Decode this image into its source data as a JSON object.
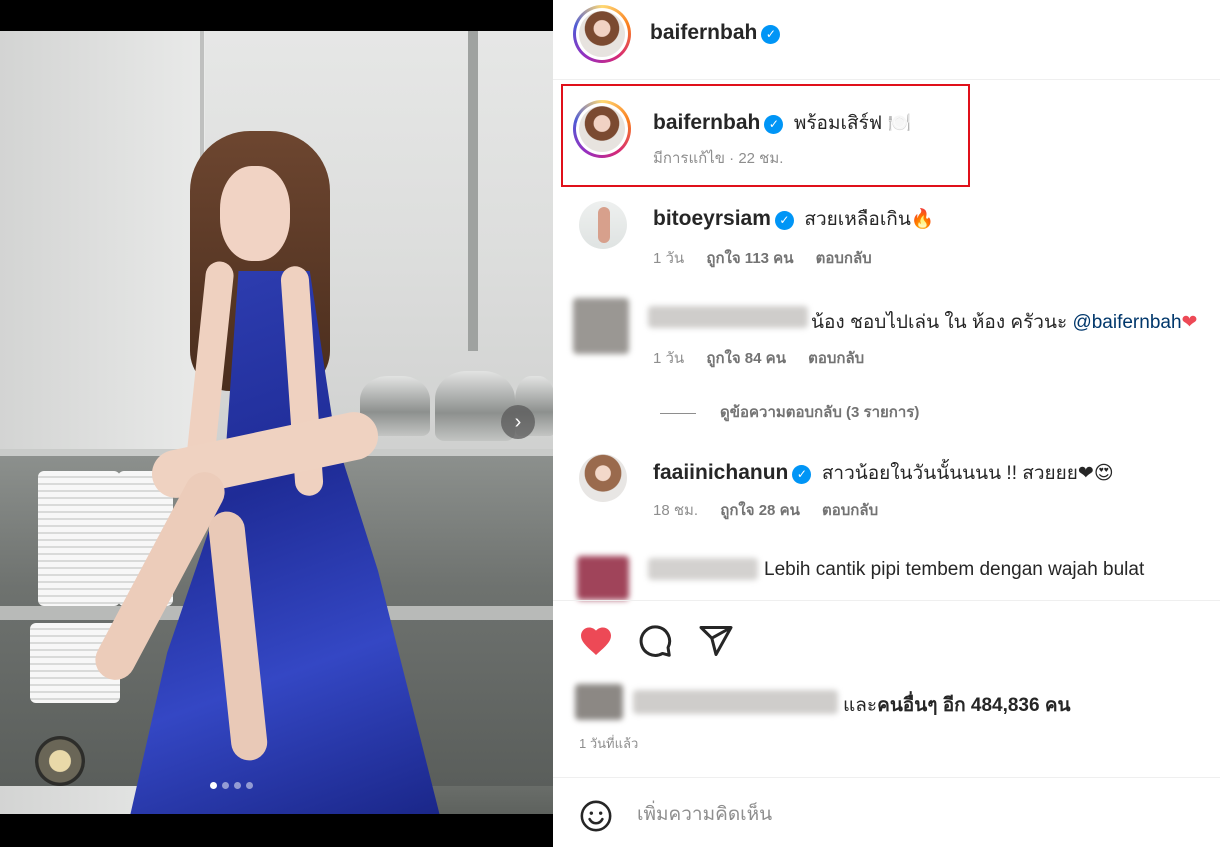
{
  "post": {
    "image_slides": 4,
    "active_slide": 1
  },
  "header": {
    "username": "baifernbah",
    "verified_glyph": "✓"
  },
  "caption": {
    "username": "baifernbah",
    "text": "พร้อมเสิร์ฟ 🍽️",
    "edited_label": "มีการแก้ไข · 22 ชม."
  },
  "comments": [
    {
      "username": "bitoeyrsiam",
      "text": "สวยเหลือเกิน🔥",
      "time": "1 วัน",
      "likes": "ถูกใจ 113 คน",
      "reply": "ตอบกลับ"
    },
    {
      "username": "",
      "text": "น้อง ชอบไปเล่น ใน ห้อง ครัวนะ ",
      "mention": "@baifernbah",
      "emoji": "❤",
      "time": "1 วัน",
      "likes": "ถูกใจ 84 คน",
      "reply": "ตอบกลับ",
      "view_replies": "ดูข้อความตอบกลับ (3 รายการ)"
    },
    {
      "username": "faaiinichanun",
      "text": "สาวน้อยในวันนั้นนนน !! สวยยย❤😍",
      "time": "18 ชม.",
      "likes": "ถูกใจ 28 คน",
      "reply": "ตอบกลับ"
    },
    {
      "username": "",
      "text": "Lebih cantik pipi tembem dengan wajah bulat"
    }
  ],
  "actions": {
    "like_icon": "heart-filled-icon",
    "comment_icon": "comment-bubble-icon",
    "share_icon": "paper-plane-icon",
    "like_color": "#ed4956"
  },
  "likes_summary": {
    "prefix": "และ",
    "bold": "คนอื่นๆ อีก 484,836 คน"
  },
  "timestamp": "1 วันที่แล้ว",
  "add_comment": {
    "placeholder": "เพิ่มความคิดเห็น",
    "emoji_icon": "smiley-icon"
  },
  "colors": {
    "verified": "#0095f6",
    "highlight": "#e0101a",
    "link": "#00376b"
  }
}
